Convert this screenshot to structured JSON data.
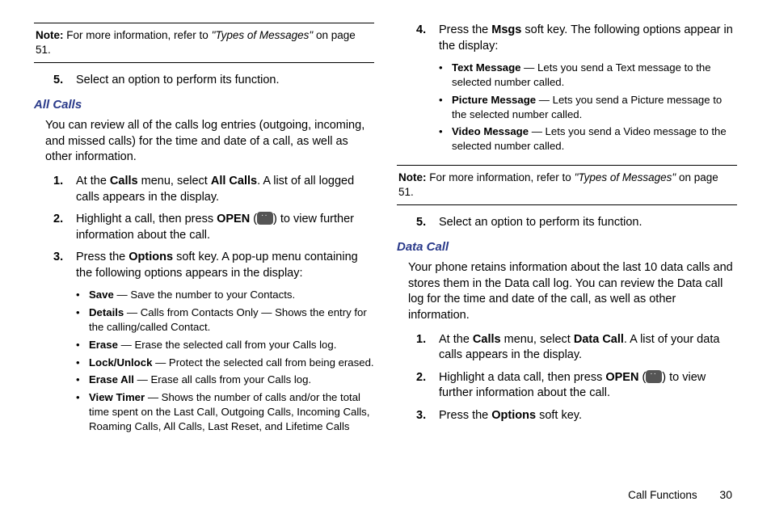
{
  "left": {
    "note": {
      "label": "Note:",
      "pre": " For more information, refer to ",
      "quote": "\"Types of Messages\"",
      "post": "  on page 51."
    },
    "step5": {
      "n": "5.",
      "t": "Select an option to perform its function."
    },
    "sec_title": "All Calls",
    "intro": "You can review all of the calls log entries (outgoing, incoming, and missed calls) for the time and date of a call, as well as other information.",
    "s1": {
      "n": "1.",
      "p1": "At the ",
      "b1": "Calls",
      "p2": " menu, select ",
      "b2": "All Calls",
      "p3": ". A list of all logged calls appears in the display."
    },
    "s2": {
      "n": "2.",
      "p1": "Highlight a call, then press ",
      "b1": "OPEN",
      "p2": " (",
      "p3": ") to view further information about the call."
    },
    "s3": {
      "n": "3.",
      "p1": "Press the ",
      "b1": "Options",
      "p2": " soft key. A pop-up menu containing the following options appears in the display:"
    },
    "bSave": {
      "b": "Save",
      "t": " — Save the number to your Contacts."
    },
    "bDetails": {
      "b": "Details",
      "t": " — Calls from Contacts Only — Shows the entry for the calling/called Contact."
    },
    "bErase": {
      "b": "Erase",
      "t": " — Erase the selected call from your Calls log."
    },
    "bLock": {
      "b": "Lock/Unlock",
      "t": " — Protect the selected call from being erased."
    },
    "bEraseAll": {
      "b": "Erase All",
      "t": " — Erase all calls from your Calls log."
    },
    "bView": {
      "b": "View Timer",
      "t": " — Shows the number of calls and/or the total time spent on the Last Call, Outgoing Calls, Incoming Calls, Roaming Calls, All Calls, Last Reset, and Lifetime Calls"
    }
  },
  "right": {
    "s4": {
      "n": "4.",
      "p1": "Press the ",
      "b1": "Msgs",
      "p2": " soft key. The following options appear in the display:"
    },
    "bText": {
      "b": "Text Message",
      "t": " — Lets you send a Text message to the selected number called."
    },
    "bPic": {
      "b": "Picture Message",
      "t": " — Lets you send a Picture message to the selected number called."
    },
    "bVid": {
      "b": "Video Message",
      "t": " — Lets you send a Video message to the selected number called."
    },
    "note": {
      "label": "Note:",
      "pre": " For more information, refer to ",
      "quote": "\"Types of Messages\"",
      "post": "  on page 51."
    },
    "s5": {
      "n": "5.",
      "t": "Select an option to perform its function."
    },
    "sec_title": "Data Call",
    "intro": "Your phone retains information about the last 10 data calls and stores them in the Data call log. You can review the Data call log for the time and date of the call, as well as other information.",
    "d1": {
      "n": "1.",
      "p1": "At the ",
      "b1": "Calls",
      "p2": " menu, select ",
      "b2": "Data Call",
      "p3": ". A list of your data calls appears in the display."
    },
    "d2": {
      "n": "2.",
      "p1": "Highlight a data call, then press ",
      "b1": "OPEN",
      "p2": " (",
      "p3": ") to view further information about the call."
    },
    "d3": {
      "n": "3.",
      "p1": "Press the ",
      "b1": "Options",
      "p2": " soft key."
    }
  },
  "footer": {
    "label": "Call Functions",
    "page": "30"
  }
}
